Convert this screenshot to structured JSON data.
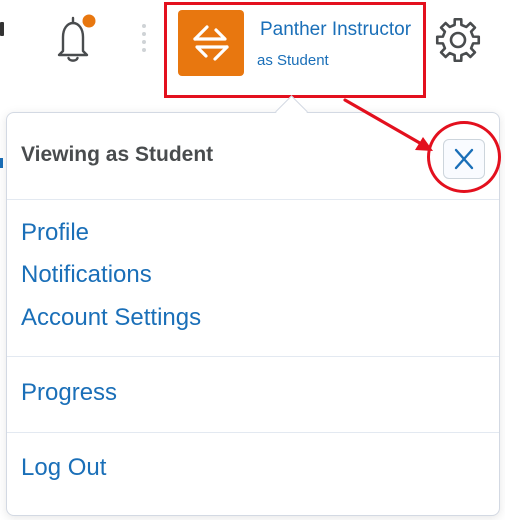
{
  "header": {
    "user_name": "Panther Instructor",
    "user_role": "as Student",
    "notification_dot_color": "#e8770f",
    "avatar_color": "#e8770f",
    "avatar_icon": "role-switch-icon"
  },
  "panel": {
    "title": "Viewing as Student",
    "close_icon": "close-icon",
    "groups": [
      [
        "Profile",
        "Notifications",
        "Account Settings"
      ],
      [
        "Progress"
      ],
      [
        "Log Out"
      ]
    ]
  },
  "annotation": {
    "color": "#e3101e"
  }
}
